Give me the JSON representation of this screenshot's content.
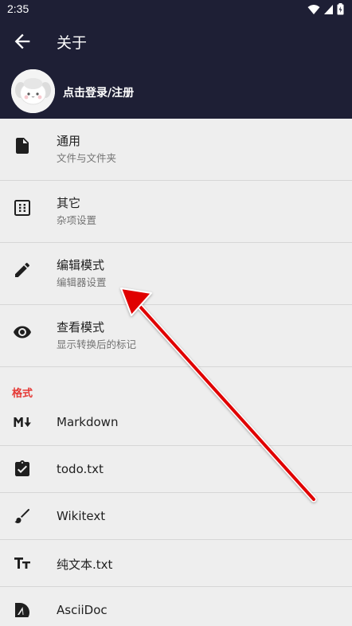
{
  "status_bar": {
    "time": "2:35"
  },
  "app_bar": {
    "title": "关于",
    "back_icon": "arrow-left-icon"
  },
  "profile": {
    "label": "点击登录/注册"
  },
  "settings": [
    {
      "icon": "file-icon",
      "title": "通用",
      "subtitle": "文件与文件夹"
    },
    {
      "icon": "dotted-box-icon",
      "title": "其它",
      "subtitle": "杂项设置"
    },
    {
      "icon": "pencil-icon",
      "title": "编辑模式",
      "subtitle": "编辑器设置"
    },
    {
      "icon": "eye-icon",
      "title": "查看模式",
      "subtitle": "显示转换后的标记"
    }
  ],
  "formats_section": {
    "title": "格式",
    "items": [
      {
        "icon": "markdown-icon",
        "label": "Markdown"
      },
      {
        "icon": "clipboard-check-icon",
        "label": "todo.txt"
      },
      {
        "icon": "brush-icon",
        "label": "Wikitext"
      },
      {
        "icon": "text-size-icon",
        "label": "纯文本.txt"
      },
      {
        "icon": "asciidoc-icon",
        "label": "AsciiDoc"
      }
    ]
  },
  "colors": {
    "header_bg": "#1e1f35",
    "accent": "#e53935",
    "arrow": "#e00000"
  }
}
